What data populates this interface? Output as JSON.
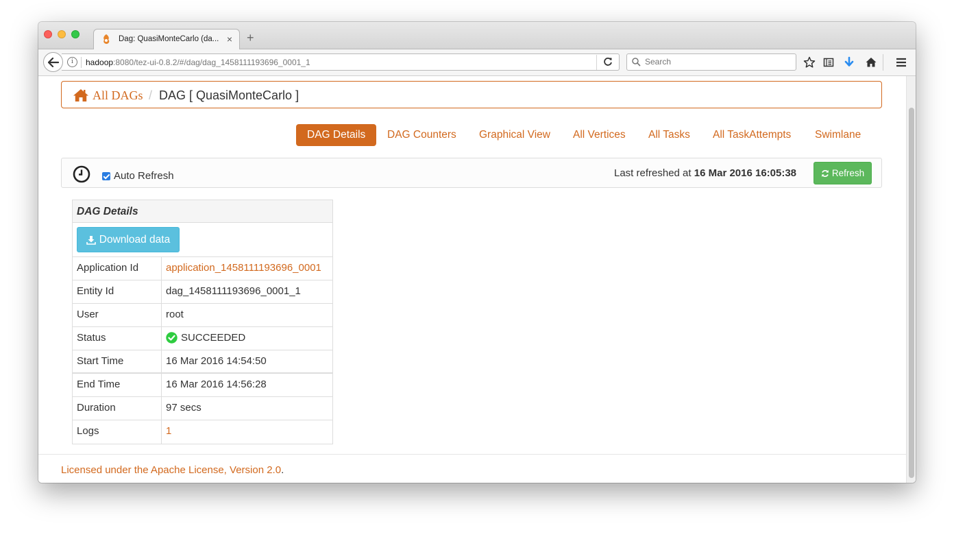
{
  "browser": {
    "tab_title": "Dag: QuasiMonteCarlo (da...",
    "new_tab_symbol": "+",
    "tab_close_symbol": "×",
    "url_host": "hadoop",
    "url_rest": ":8080/tez-ui-0.8.2/#/dag/dag_1458111193696_0001_1",
    "search_placeholder": "Search"
  },
  "breadcrumb": {
    "home_label": "All DAGs",
    "separator": "/",
    "current": "DAG [ QuasiMonteCarlo ]"
  },
  "tabs": [
    {
      "label": "DAG Details",
      "active": true
    },
    {
      "label": "DAG Counters"
    },
    {
      "label": "Graphical View"
    },
    {
      "label": "All Vertices"
    },
    {
      "label": "All Tasks"
    },
    {
      "label": "All TaskAttempts"
    },
    {
      "label": "Swimlane"
    }
  ],
  "refresh": {
    "auto_refresh_label": "Auto Refresh",
    "auto_refresh_checked": true,
    "last_refreshed_prefix": "Last refreshed at",
    "last_refreshed_time": "16 Mar 2016 16:05:38",
    "button_label": "Refresh"
  },
  "details": {
    "header": "DAG Details",
    "download_label": "Download data",
    "rows": [
      {
        "key": "Application Id",
        "value": "application_1458111193696_0001"
      },
      {
        "key": "Entity Id",
        "value": "dag_1458111193696_0001_1"
      },
      {
        "key": "User",
        "value": "root"
      },
      {
        "key": "Status",
        "value": "SUCCEEDED"
      },
      {
        "key": "Start Time",
        "value": "16 Mar 2016 14:54:50"
      },
      {
        "key": "End Time",
        "value": "16 Mar 2016 14:56:28"
      },
      {
        "key": "Duration",
        "value": "97 secs"
      },
      {
        "key": "Logs",
        "value": "1"
      }
    ]
  },
  "footer": {
    "link_text": "Licensed under the Apache License, Version 2.0",
    "suffix": "."
  },
  "colors": {
    "accent": "#d2691e",
    "success": "#5cb85c",
    "info": "#5bc0de",
    "status_ok": "#2ecc40"
  },
  "icons": {
    "home": "home-icon",
    "clock": "clock-icon",
    "refresh": "refresh-icon",
    "download": "download-icon",
    "status": "check-circle-icon"
  }
}
